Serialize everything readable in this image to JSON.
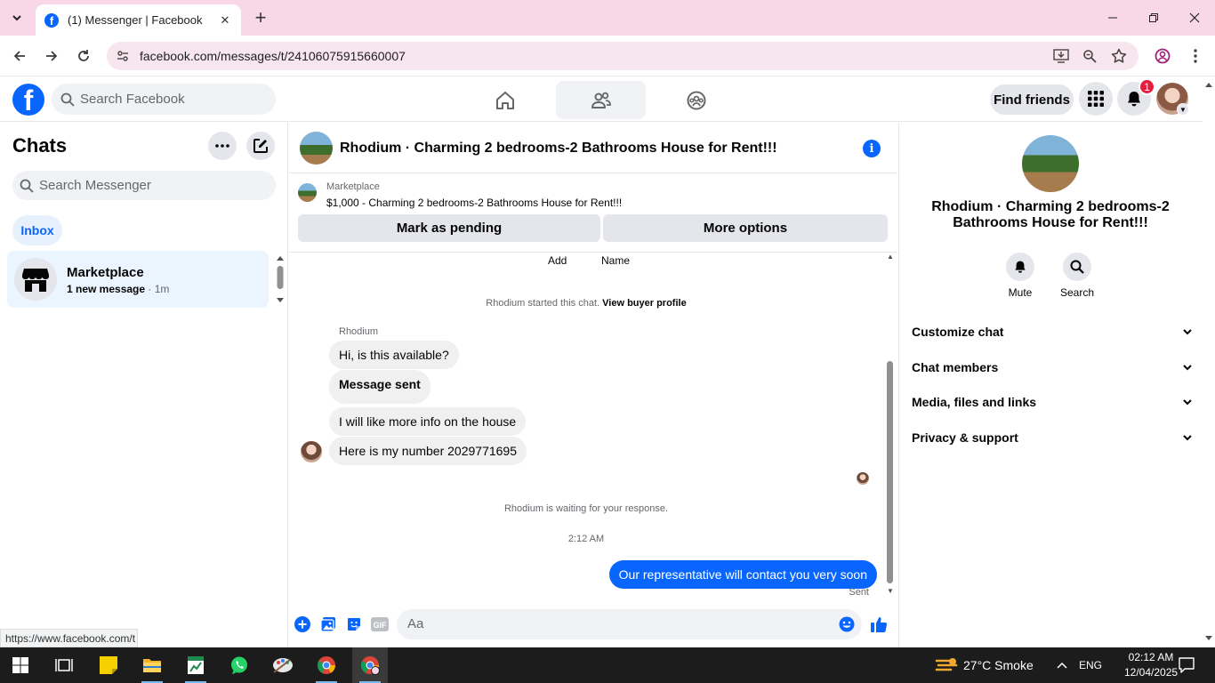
{
  "browser": {
    "tab_title": "(1) Messenger | Facebook",
    "url": "facebook.com/messages/t/24106075915660007",
    "status_url": "https://www.facebook.com/t"
  },
  "fb": {
    "search_placeholder": "Search Facebook",
    "find_friends": "Find friends",
    "notification_count": "1"
  },
  "chats": {
    "title": "Chats",
    "search_placeholder": "Search Messenger",
    "inbox_label": "Inbox",
    "items": [
      {
        "name": "Marketplace",
        "preview": "1 new message",
        "time": " · 1m"
      }
    ]
  },
  "conversation": {
    "title": "Rhodium · Charming 2 bedrooms-2 Bathrooms House for Rent!!!",
    "marketplace_label": "Marketplace",
    "listing": "$1,000 - Charming 2 bedrooms-2 Bathrooms House for Rent!!!",
    "mark_pending": "Mark as pending",
    "more_options": "More options",
    "add_label": "Add",
    "name_label": "Name",
    "started_text": "Rhodium started this chat. ",
    "view_profile": "View buyer profile",
    "sender": "Rhodium",
    "messages": [
      "Hi, is this available?",
      "Message sent",
      "I will like more info on the house",
      "Here is my number 2029771695"
    ],
    "waiting_text": "Rhodium is waiting for your response.",
    "timestamp": "2:12 AM",
    "outgoing": "Our representative will contact you very soon",
    "sent_label": "Sent",
    "composer_placeholder": "Aa"
  },
  "info_panel": {
    "title": "Rhodium · Charming 2 bedrooms-2 Bathrooms House for Rent!!!",
    "mute": "Mute",
    "search": "Search",
    "sections": [
      "Customize chat",
      "Chat members",
      "Media, files and links",
      "Privacy & support"
    ]
  },
  "taskbar": {
    "weather": "27°C  Smoke",
    "language": "ENG",
    "time": "02:12 AM",
    "date": "12/04/2025"
  },
  "colors": {
    "brand": "#0866ff",
    "tabstrip": "#f8d8e6",
    "badge": "#e41e3f"
  }
}
